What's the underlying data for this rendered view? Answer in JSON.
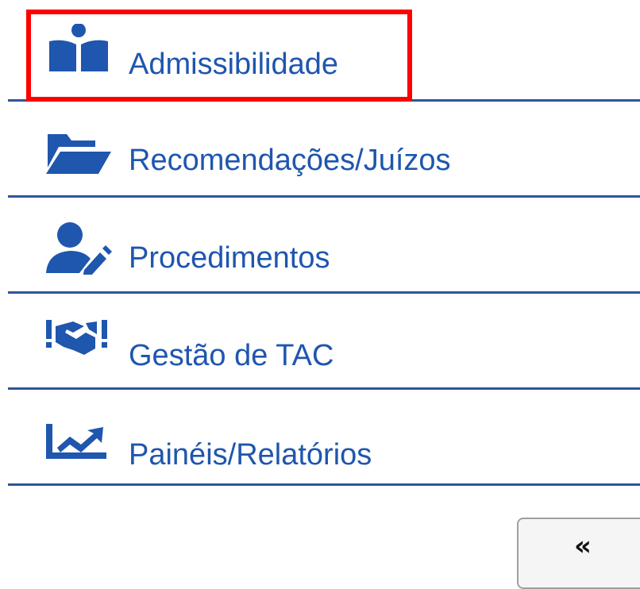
{
  "menu": {
    "items": [
      {
        "id": "admissibilidade",
        "label": "Admissibilidade",
        "icon": "book-reader-icon"
      },
      {
        "id": "recomendacoes",
        "label": "Recomendações/Juízos",
        "icon": "folder-open-icon"
      },
      {
        "id": "procedimentos",
        "label": "Procedimentos",
        "icon": "user-edit-icon"
      },
      {
        "id": "gestao-tac",
        "label": "Gestão de TAC",
        "icon": "handshake-alert-icon"
      },
      {
        "id": "paineis",
        "label": "Painéis/Relatórios",
        "icon": "chart-line-icon"
      }
    ],
    "collapse_label": "«"
  },
  "colors": {
    "primary": "#1f56ae",
    "divider": "#2f5597",
    "highlight": "#ff0000"
  }
}
